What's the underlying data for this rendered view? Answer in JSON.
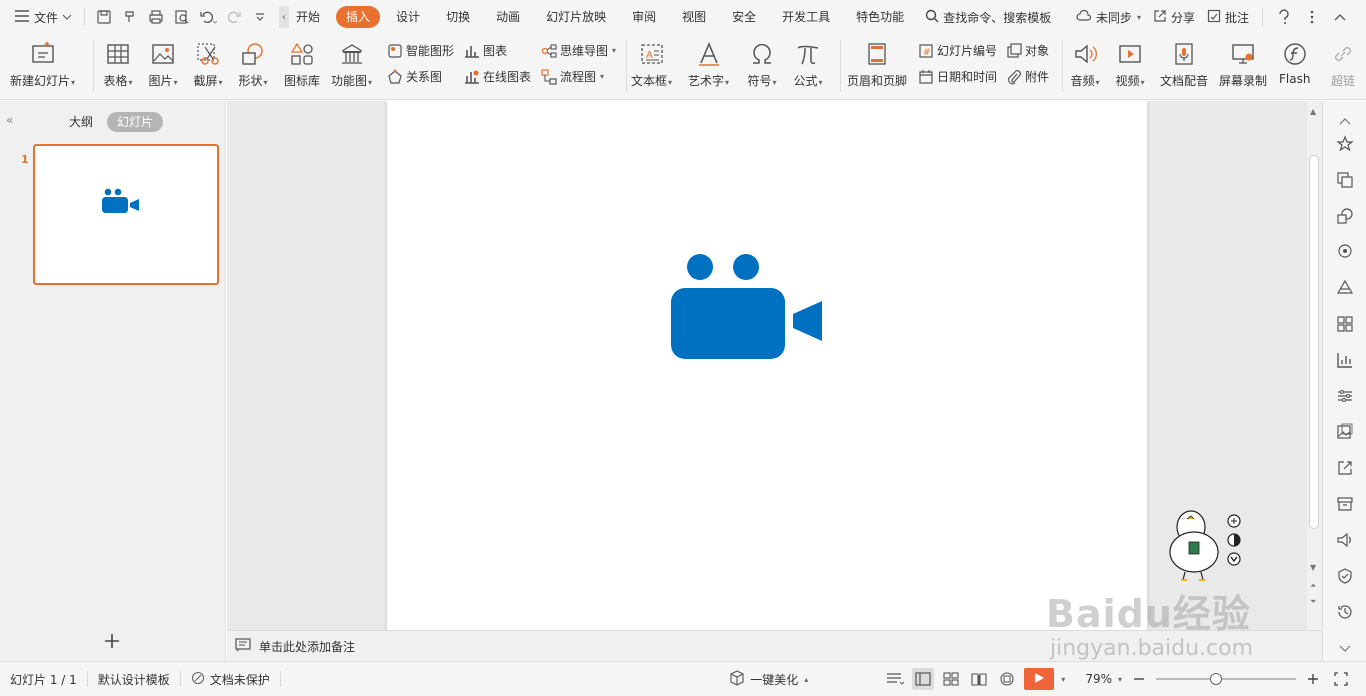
{
  "menubar": {
    "file_label": "文件",
    "tabs": [
      "开始",
      "插入",
      "设计",
      "切换",
      "动画",
      "幻灯片放映",
      "审阅",
      "视图",
      "安全",
      "开发工具",
      "特色功能"
    ],
    "active_tab_index": 1,
    "search_label": "查找命令、搜索模板",
    "sync_label": "未同步",
    "share_label": "分享",
    "comment_label": "批注"
  },
  "ribbon": {
    "new_slide": "新建幻灯片",
    "table": "表格",
    "picture": "图片",
    "screenshot": "截屏",
    "shape": "形状",
    "icon_lib": "图标库",
    "func_chart": "功能图",
    "smart_art": "智能图形",
    "chart": "图表",
    "relation": "关系图",
    "online_chart": "在线图表",
    "mindmap": "思维导图",
    "flowchart": "流程图",
    "textbox": "文本框",
    "wordart": "艺术字",
    "symbol": "符号",
    "formula": "公式",
    "header_footer": "页眉和页脚",
    "slide_number": "幻灯片编号",
    "object": "对象",
    "date_time": "日期和时间",
    "attachment": "附件",
    "audio": "音频",
    "video": "视频",
    "doc_audio": "文档配音",
    "screen_record": "屏幕录制",
    "flash": "Flash",
    "hyperlink": "超链"
  },
  "leftpanel": {
    "outline_tab": "大纲",
    "slides_tab": "幻灯片",
    "slide_number": "1"
  },
  "notes": {
    "placeholder": "单击此处添加备注"
  },
  "statusbar": {
    "slide_info": "幻灯片 1 / 1",
    "template": "默认设计模板",
    "protection": "文档未保护",
    "beautify": "一键美化",
    "zoom": "79%"
  },
  "watermark": {
    "brand": "Baidu经验",
    "site": "jingyan.baidu.com"
  },
  "colors": {
    "accent": "#e8712f",
    "camera_blue": "#0070c0"
  },
  "icons": {
    "slide_content": "video-camera-icon"
  }
}
